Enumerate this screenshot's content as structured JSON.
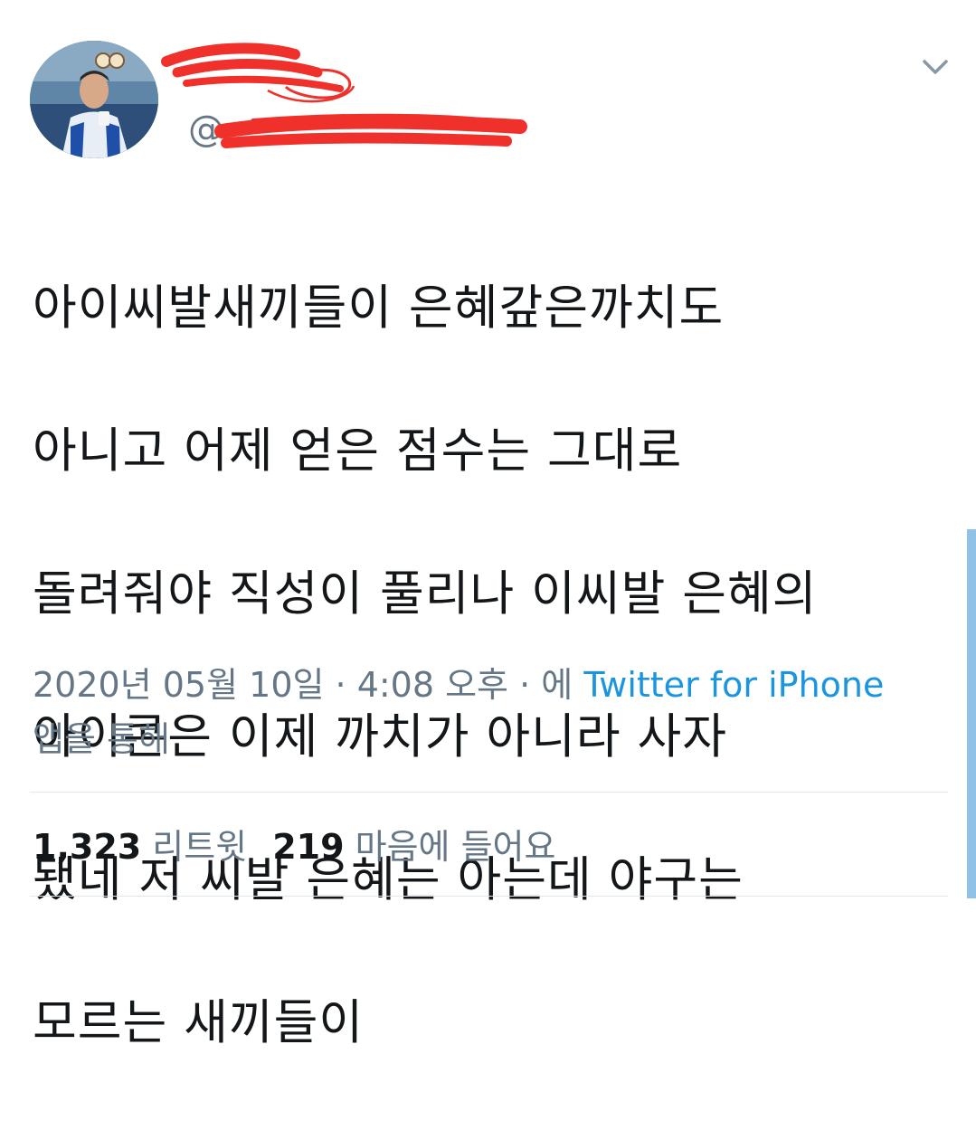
{
  "tweet": {
    "handle_prefix": "@",
    "lines": [
      "아이씨발새끼들이 은혜갚은까치도",
      "아니고 어제 얻은 점수는 그대로",
      "돌려줘야 직성이 풀리나 이씨발 은혜의",
      "아이콘은 이제 까치가 아니라 사자",
      "됐네 저 씨발 은혜는 아는데 야구는",
      "모르는 새끼들이"
    ],
    "timestamp": "2020년 05월 10일 · 4:08 오후 · 에",
    "source_app": "Twitter for iPhone",
    "source_suffix": "앱을 통해"
  },
  "stats": {
    "retweets_count": "1,323",
    "retweets_label": "리트윗",
    "likes_count": "219",
    "likes_label": "마음에 들어요"
  },
  "icons": {
    "menu": "chevron-down-icon"
  },
  "colors": {
    "text": "#14171a",
    "secondary": "#657786",
    "link": "#1b95e0",
    "redaction": "#f0302a",
    "divider": "#e1e8ed"
  }
}
